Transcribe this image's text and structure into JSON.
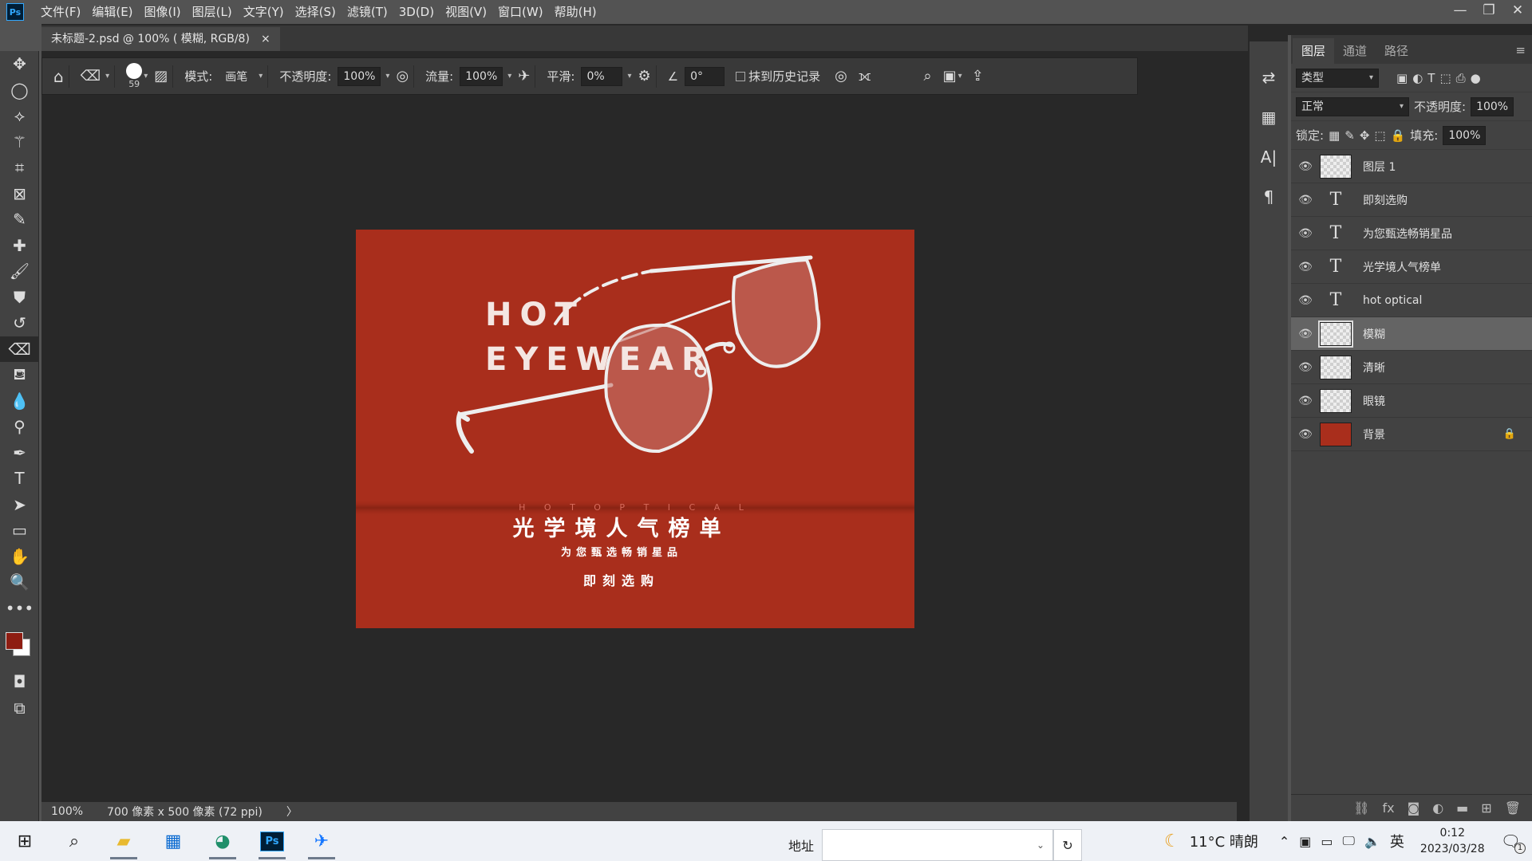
{
  "app": {
    "logo": "Ps"
  },
  "menu": [
    "文件(F)",
    "编辑(E)",
    "图像(I)",
    "图层(L)",
    "文字(Y)",
    "选择(S)",
    "滤镜(T)",
    "3D(D)",
    "视图(V)",
    "窗口(W)",
    "帮助(H)"
  ],
  "window_controls": {
    "minimize": "—",
    "restore": "❐",
    "close": "✕"
  },
  "document_tab": {
    "title": "未标题-2.psd @ 100% ( 模糊, RGB/8)",
    "close": "×"
  },
  "options_bar": {
    "brush_size": "59",
    "mode_label": "模式:",
    "mode_value": "画笔",
    "opacity_label": "不透明度:",
    "opacity_value": "100%",
    "flow_label": "流量:",
    "flow_value": "100%",
    "smoothing_label": "平滑:",
    "smoothing_value": "0%",
    "angle_value": "0°",
    "erase_history_label": "抹到历史记录"
  },
  "artwork": {
    "headline_line1": "HOT",
    "headline_line2": "EYEWEAR",
    "small_caps": "H O T   O P T I C A L",
    "title": "光学境人气榜单",
    "subtitle": "为您甄选畅销星品",
    "cta": "即刻选购",
    "background_color": "#a92e1c"
  },
  "status_bar": {
    "zoom": "100%",
    "doc_size": "700 像素 x 500 像素 (72 ppi)",
    "arrow": "〉"
  },
  "layers_panel": {
    "tabs": [
      "图层",
      "通道",
      "路径"
    ],
    "filter_kind": "类型",
    "blend_mode": "正常",
    "opacity_label": "不透明度:",
    "opacity_value": "100%",
    "lock_label": "锁定:",
    "fill_label": "填充:",
    "fill_value": "100%",
    "layers": [
      {
        "name": "图层 1",
        "kind": "pixel"
      },
      {
        "name": "即刻选购",
        "kind": "text"
      },
      {
        "name": "为您甄选畅销星品",
        "kind": "text"
      },
      {
        "name": "光学境人气榜单",
        "kind": "text"
      },
      {
        "name": "hot optical",
        "kind": "text"
      },
      {
        "name": "模糊",
        "kind": "pixel",
        "selected": true
      },
      {
        "name": "清晰",
        "kind": "pixel"
      },
      {
        "name": "眼镜",
        "kind": "smart"
      },
      {
        "name": "背景",
        "kind": "fill",
        "locked": true
      }
    ]
  },
  "taskbar": {
    "address_label": "地址",
    "weather": "11°C 晴朗",
    "ime": "英",
    "time": "0:12",
    "date": "2023/03/28",
    "notification_count": "1"
  },
  "colors": {
    "foreground": "#8e1d12",
    "background": "#ffffff"
  }
}
